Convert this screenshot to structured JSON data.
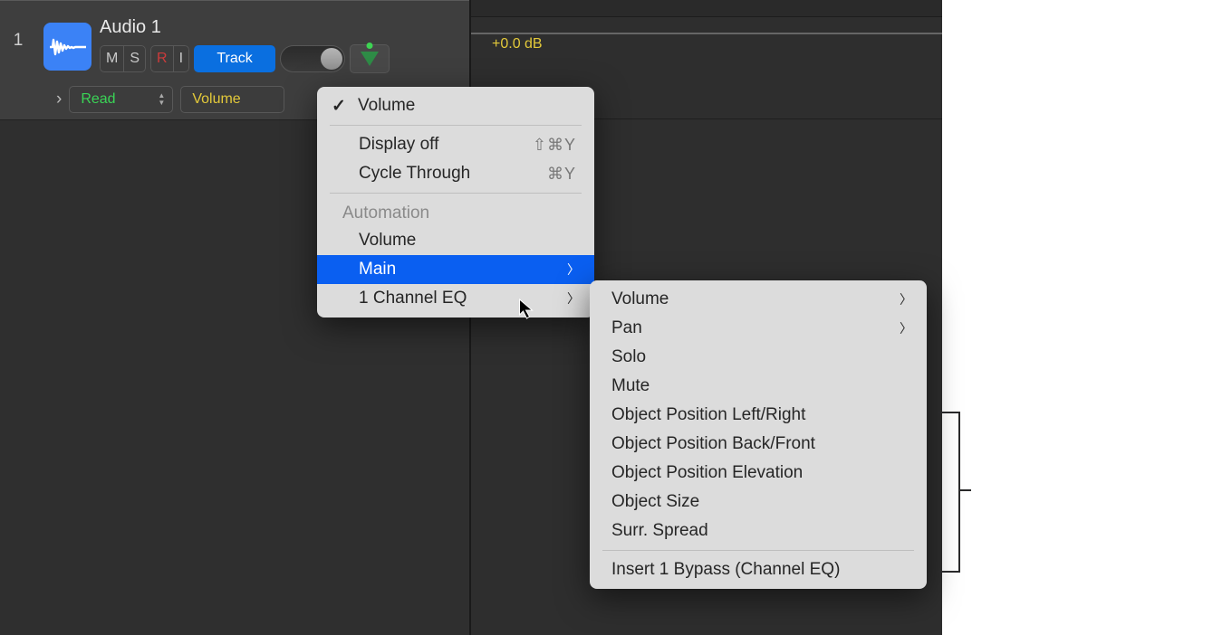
{
  "track": {
    "number": "1",
    "name": "Audio 1",
    "buttons": {
      "mute": "M",
      "solo": "S",
      "record": "R",
      "input": "I",
      "track": "Track"
    },
    "automation": {
      "disclosure": "›",
      "mode": "Read",
      "parameter": "Volume"
    }
  },
  "timeline": {
    "db_label": "+0.0 dB"
  },
  "menu": {
    "current": "Volume",
    "display_off": "Display off",
    "display_off_shortcut": "⇧⌘Y",
    "cycle_through": "Cycle Through",
    "cycle_through_shortcut": "⌘Y",
    "section_automation": "Automation",
    "item_volume": "Volume",
    "item_main": "Main",
    "item_channeleq": "1 Channel EQ"
  },
  "submenu": {
    "volume": "Volume",
    "pan": "Pan",
    "solo": "Solo",
    "mute": "Mute",
    "obj_lr": "Object Position Left/Right",
    "obj_bf": "Object Position Back/Front",
    "obj_elev": "Object Position Elevation",
    "obj_size": "Object Size",
    "surr_spread": "Surr. Spread",
    "insert_bypass": "Insert 1 Bypass (Channel EQ)"
  }
}
